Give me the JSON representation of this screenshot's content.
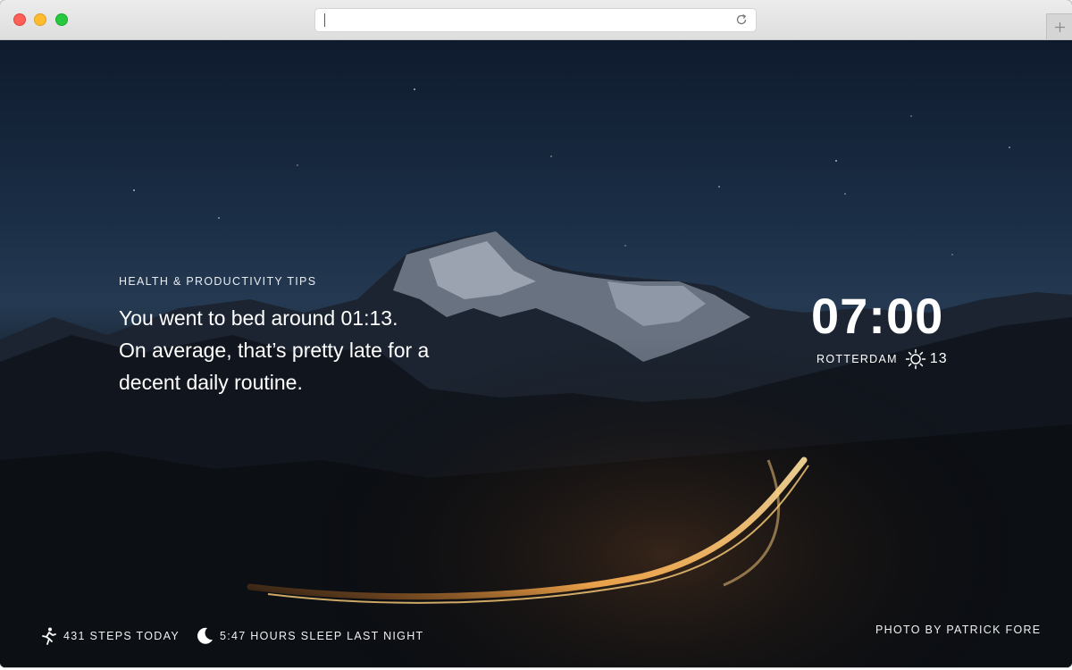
{
  "browser": {
    "address_value": "",
    "reload_icon": "reload-icon",
    "new_tab_icon": "plus-icon",
    "traffic_lights": {
      "close": "#fe5f57",
      "minimize": "#febc2e",
      "zoom": "#28c840"
    }
  },
  "tips": {
    "heading": "HEALTH & PRODUCTIVITY TIPS",
    "lines": [
      "You went to bed around 01:13.",
      "On average, that’s pretty late for a",
      "decent daily routine."
    ]
  },
  "clock": {
    "time": "07:00",
    "city": "ROTTERDAM",
    "weather_icon": "sun-icon",
    "temperature": "13"
  },
  "footer": {
    "steps": {
      "icon": "running-person-icon",
      "label": "431 STEPS TODAY"
    },
    "sleep": {
      "icon": "moon-icon",
      "label": "5:47 HOURS SLEEP LAST NIGHT"
    },
    "credit": "PHOTO BY PATRICK FORE"
  }
}
